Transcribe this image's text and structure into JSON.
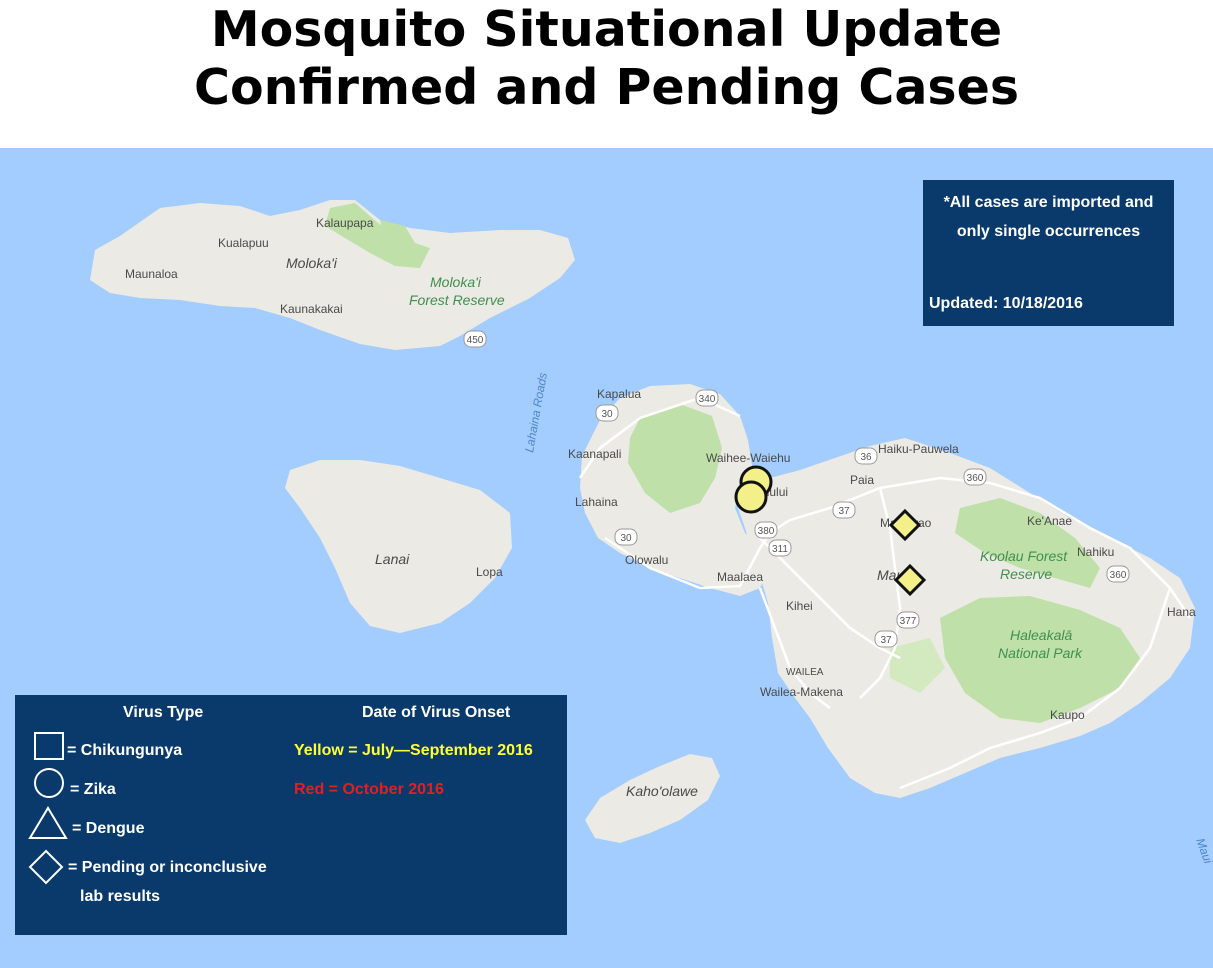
{
  "title": {
    "line1": "Mosquito Situational Update",
    "line2": "Confirmed and Pending Cases"
  },
  "info_box": {
    "note_line1": "*All cases are imported and",
    "note_line2": "only single occurrences",
    "updated": "Updated: 10/18/2016"
  },
  "legend": {
    "virus_type_heading": "Virus Type",
    "onset_heading": "Date of Virus Onset",
    "items": [
      {
        "symbol": "square",
        "label": "= Chikungunya"
      },
      {
        "symbol": "circle",
        "label": "= Zika"
      },
      {
        "symbol": "triangle",
        "label": "= Dengue"
      },
      {
        "symbol": "diamond",
        "label": "= Pending or inconclusive",
        "label2": "lab results"
      }
    ],
    "onset_yellow": "Yellow = July—September 2016",
    "onset_red": "Red = October 2016",
    "colors": {
      "yellow": "#ffff33",
      "red": "#e02020",
      "panel": "#0a3a6b"
    }
  },
  "map": {
    "colors": {
      "ocean": "#a3ccff",
      "land": "#eceae4",
      "forest": "#bfe0a8"
    },
    "places": {
      "kalaupapa": "Kalaupapa",
      "kualapuu": "Kualapuu",
      "maunaloa": "Maunaloa",
      "molokai": "Moloka'i",
      "molokai_forest1": "Moloka'i",
      "molokai_forest2": "Forest Reserve",
      "kaunakakai": "Kaunakakai",
      "lahaina_roads": "Lahaina Roads",
      "kapalua": "Kapalua",
      "kaanapali": "Kaanapali",
      "lahaina": "Lahaina",
      "olowalu": "Olowalu",
      "waihee": "Waihee-Waiehu",
      "kahului": "Kahului",
      "maalaea": "Maalaea",
      "kihei": "Kihei",
      "wailea": "WAILEA",
      "wailea_makena": "Wailea-Makena",
      "haiku": "Haiku-Pauwela",
      "paia": "Paia",
      "makawao": "Makawao",
      "keanae": "Ke'Anae",
      "nahiku": "Nahiku",
      "koolau1": "Koolau Forest",
      "koolau2": "Reserve",
      "maui": "Maui",
      "hana": "Hana",
      "haleakala1": "Haleakalā",
      "haleakala2": "National Park",
      "kaupo": "Kaupo",
      "lanai": "Lanai",
      "lopa": "Lopa",
      "kahoolawe": "Kaho'olawe",
      "maui_edge": "Maui"
    },
    "routes": [
      "450",
      "340",
      "30",
      "30",
      "380",
      "311",
      "36",
      "37",
      "360",
      "360",
      "377",
      "37"
    ]
  },
  "cases": [
    {
      "virus": "Zika",
      "status": "confirmed",
      "onset": "July—September 2016",
      "color": "#f3f08a"
    },
    {
      "virus": "Zika",
      "status": "confirmed",
      "onset": "July—September 2016",
      "color": "#f3f08a"
    },
    {
      "virus": "Pending",
      "status": "pending",
      "onset": "July—September 2016",
      "color": "#f3f08a"
    },
    {
      "virus": "Pending",
      "status": "pending",
      "onset": "July—September 2016",
      "color": "#f3f08a"
    }
  ]
}
